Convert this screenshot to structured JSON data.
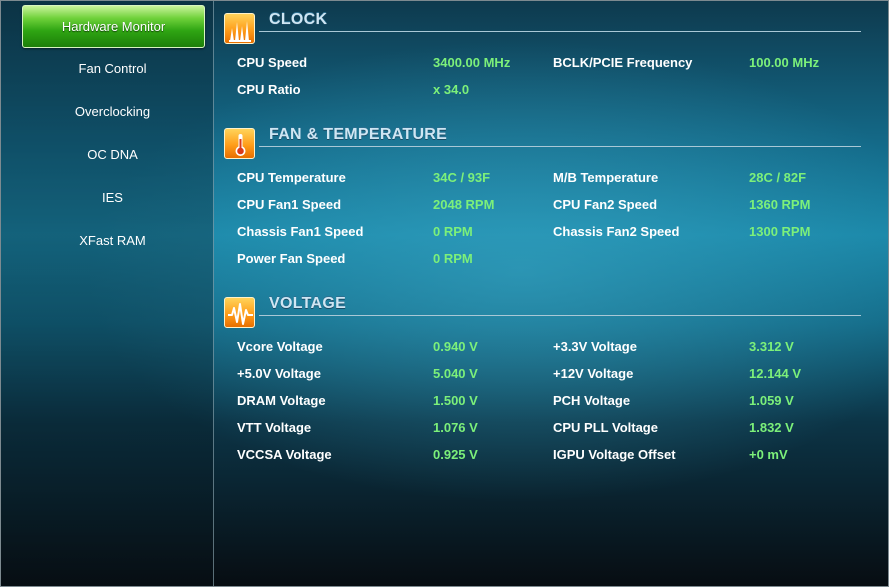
{
  "sidebar": {
    "items": [
      {
        "label": "Hardware Monitor",
        "active": true
      },
      {
        "label": "Fan Control",
        "active": false
      },
      {
        "label": "Overclocking",
        "active": false
      },
      {
        "label": "OC DNA",
        "active": false
      },
      {
        "label": "IES",
        "active": false
      },
      {
        "label": "XFast RAM",
        "active": false
      }
    ]
  },
  "colors": {
    "value_green": "#7cf07a",
    "active_tab_green": "#2fa513",
    "icon_orange": "#ff9e1a"
  },
  "clock": {
    "title": "CLOCK",
    "icon": "clock-bars-icon",
    "cpu_speed_label": "CPU Speed",
    "cpu_speed_value": "3400.00 MHz",
    "bclk_label": "BCLK/PCIE Frequency",
    "bclk_value": "100.00 MHz",
    "cpu_ratio_label": "CPU Ratio",
    "cpu_ratio_value": "x 34.0"
  },
  "fan_temp": {
    "title": "FAN & TEMPERATURE",
    "icon": "thermometer-icon",
    "cpu_temp_label": "CPU Temperature",
    "cpu_temp_value": "34C / 93F",
    "mb_temp_label": "M/B Temperature",
    "mb_temp_value": "28C / 82F",
    "cpu_fan1_label": "CPU Fan1 Speed",
    "cpu_fan1_value": "2048 RPM",
    "cpu_fan2_label": "CPU Fan2 Speed",
    "cpu_fan2_value": "1360 RPM",
    "chassis_fan1_label": "Chassis Fan1 Speed",
    "chassis_fan1_value": "0 RPM",
    "chassis_fan2_label": "Chassis Fan2 Speed",
    "chassis_fan2_value": "1300 RPM",
    "power_fan_label": "Power Fan Speed",
    "power_fan_value": "0 RPM"
  },
  "voltage": {
    "title": "VOLTAGE",
    "icon": "voltage-wave-icon",
    "vcore_label": "Vcore Voltage",
    "vcore_value": "0.940 V",
    "v33_label": "+3.3V Voltage",
    "v33_value": "3.312 V",
    "v50_label": "+5.0V Voltage",
    "v50_value": "5.040 V",
    "v12_label": "+12V Voltage",
    "v12_value": "12.144 V",
    "dram_label": "DRAM Voltage",
    "dram_value": "1.500 V",
    "pch_label": "PCH Voltage",
    "pch_value": "1.059 V",
    "vtt_label": "VTT Voltage",
    "vtt_value": "1.076 V",
    "cpu_pll_label": "CPU PLL Voltage",
    "cpu_pll_value": "1.832 V",
    "vccsa_label": "VCCSA Voltage",
    "vccsa_value": "0.925 V",
    "igpu_label": "IGPU Voltage Offset",
    "igpu_value": "+0 mV"
  }
}
